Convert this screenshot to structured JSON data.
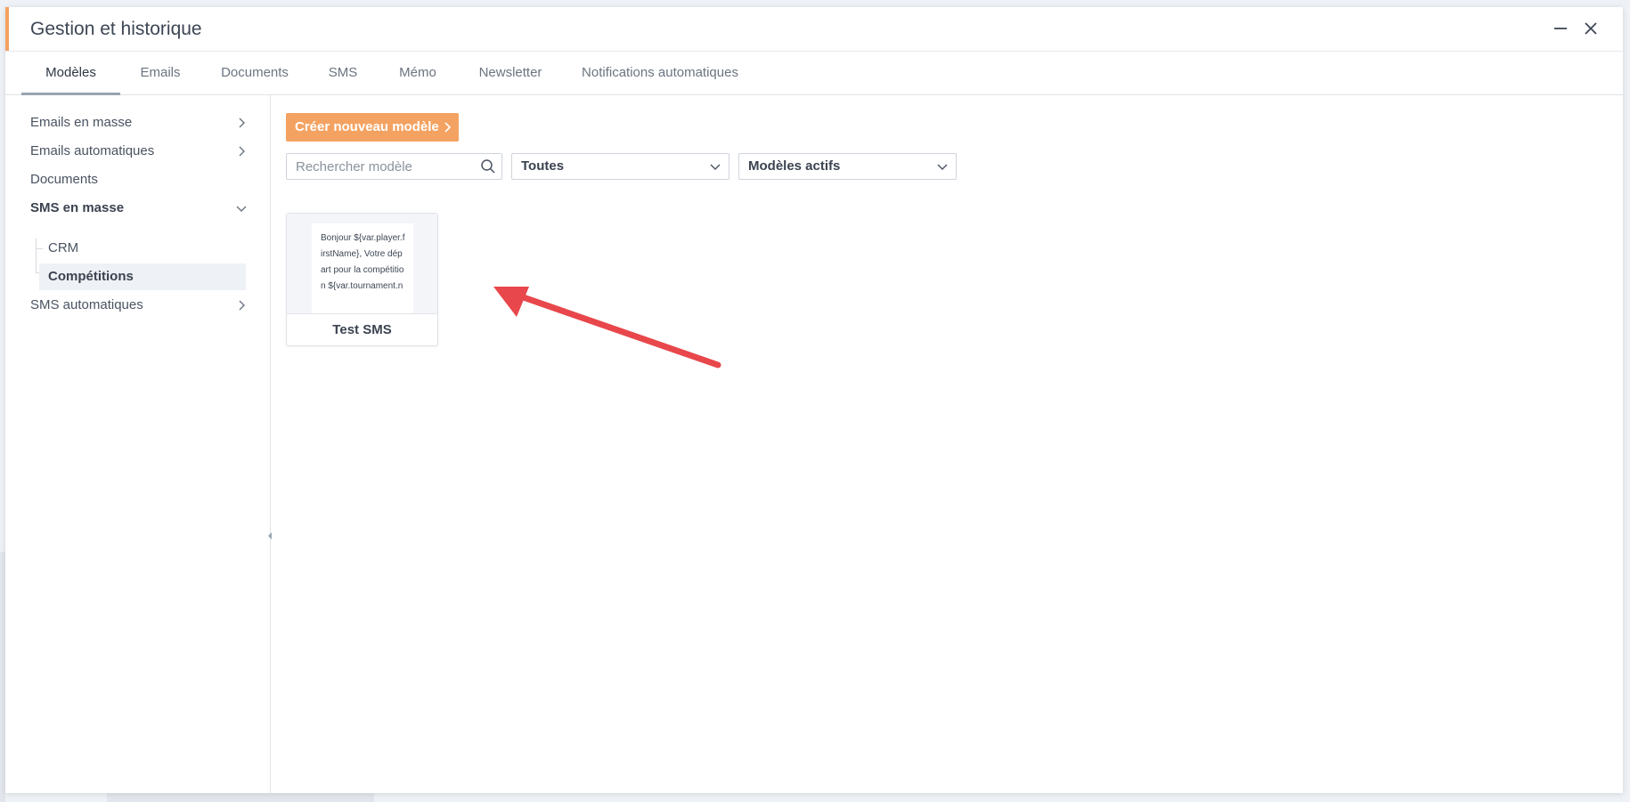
{
  "window": {
    "title": "Gestion et historique"
  },
  "tabs": [
    {
      "label": "Modèles",
      "active": true
    },
    {
      "label": "Emails"
    },
    {
      "label": "Documents"
    },
    {
      "label": "SMS"
    },
    {
      "label": "Mémo"
    },
    {
      "label": "Newsletter"
    },
    {
      "label": "Notifications automatiques"
    }
  ],
  "sidebar": {
    "items": [
      {
        "label": "Emails en masse",
        "icon": "chevron-right-icon"
      },
      {
        "label": "Emails automatiques",
        "icon": "chevron-right-icon"
      },
      {
        "label": "Documents"
      },
      {
        "label": "SMS en masse",
        "icon": "chevron-down-icon",
        "expanded": true
      },
      {
        "label": "SMS automatiques",
        "icon": "chevron-right-icon"
      }
    ],
    "subitems": [
      {
        "label": "CRM"
      },
      {
        "label": "Compétitions",
        "selected": true
      }
    ]
  },
  "toolbar": {
    "create_label": "Créer nouveau modèle",
    "search_placeholder": "Rechercher modèle",
    "category_select": "Toutes",
    "status_select": "Modèles actifs"
  },
  "templates": [
    {
      "title": "Test SMS",
      "preview": "Bonjour ${var.player.firstName}, Votre départ pour la compétition ${var.tournament.n"
    }
  ],
  "colors": {
    "accent": "#f4a261",
    "annotation_arrow": "#e8474b"
  }
}
